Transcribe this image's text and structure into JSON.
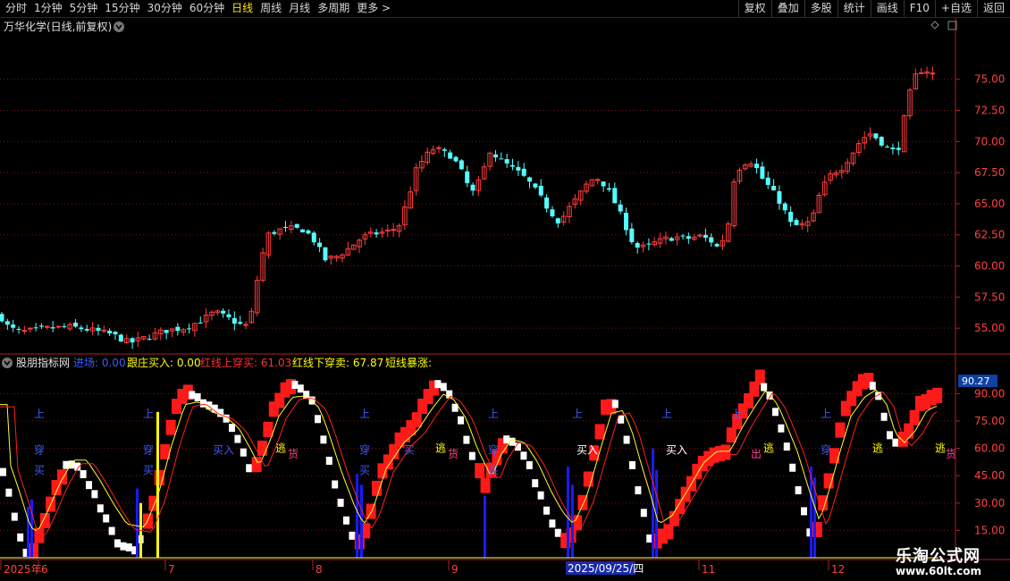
{
  "topbar": {
    "periods": [
      "分时",
      "1分钟",
      "5分钟",
      "15分钟",
      "30分钟",
      "60分钟",
      "日线",
      "周线",
      "月线",
      "多周期",
      "更多 >"
    ],
    "active_period": "日线",
    "tools": [
      "复权",
      "叠加",
      "多股",
      "统计",
      "画线",
      "F10",
      "+自选",
      "返回"
    ]
  },
  "main_panel": {
    "title": "万华化学(日线,前复权)",
    "y_ticks": [
      "75.00",
      "72.50",
      "70.00",
      "67.50",
      "65.00",
      "62.50",
      "60.00",
      "57.50",
      "55.00"
    ],
    "y_values": [
      75,
      72.5,
      70,
      67.5,
      65,
      62.5,
      60,
      57.5,
      55
    ],
    "y_range": [
      53,
      78.5
    ],
    "up_color": "#ff3c3c",
    "down_color": "#54ffff"
  },
  "indicator_panel": {
    "name": "股朋指标网",
    "legend": [
      {
        "label": "进场: 0.00",
        "color": "#3c5cff"
      },
      {
        "label": "跟庄买入: 0.00",
        "color": "#ffff00"
      },
      {
        "label": "红线上穿买: 61.03",
        "color": "#ff3030"
      },
      {
        "label": "红线下穿卖: 67.87",
        "color": "#ffff00"
      },
      {
        "label": "短线暴涨:",
        "color": "#ffff00"
      }
    ],
    "y_ticks": [
      "90.00",
      "75.00",
      "60.00",
      "45.00",
      "30.00",
      "15.00"
    ],
    "y_values": [
      90,
      75,
      60,
      45,
      30,
      15
    ],
    "y_range": [
      0,
      100
    ],
    "current_value": "90.27",
    "signals": [
      {
        "text": "上",
        "x": 38,
        "v": 77,
        "color": "#3c5cff"
      },
      {
        "text": "穿",
        "x": 38,
        "v": 57,
        "color": "#3c5cff"
      },
      {
        "text": "买",
        "x": 38,
        "v": 46,
        "color": "#3c5cff"
      },
      {
        "text": "上",
        "x": 160,
        "v": 77,
        "color": "#3c5cff"
      },
      {
        "text": "穿",
        "x": 160,
        "v": 57,
        "color": "#3c5cff"
      },
      {
        "text": "买",
        "x": 160,
        "v": 46,
        "color": "#3c5cff"
      },
      {
        "text": "买入",
        "x": 238,
        "v": 57,
        "color": "#3c5cff"
      },
      {
        "text": "逃",
        "x": 308,
        "v": 58,
        "color": "#ffff00"
      },
      {
        "text": "货",
        "x": 322,
        "v": 55,
        "color": "#ff4090"
      },
      {
        "text": "上",
        "x": 402,
        "v": 77,
        "color": "#3c5cff"
      },
      {
        "text": "穿",
        "x": 402,
        "v": 57,
        "color": "#3c5cff"
      },
      {
        "text": "买",
        "x": 402,
        "v": 46,
        "color": "#3c5cff"
      },
      {
        "text": "买",
        "x": 452,
        "v": 57,
        "color": "#3c5cff"
      },
      {
        "text": "逃",
        "x": 487,
        "v": 58,
        "color": "#ffff00"
      },
      {
        "text": "货",
        "x": 501,
        "v": 55,
        "color": "#ff4090"
      },
      {
        "text": "上",
        "x": 546,
        "v": 77,
        "color": "#3c5cff"
      },
      {
        "text": "穿",
        "x": 546,
        "v": 57,
        "color": "#3c5cff"
      },
      {
        "text": "买",
        "x": 546,
        "v": 46,
        "color": "#3c5cff"
      },
      {
        "text": "上",
        "x": 640,
        "v": 77,
        "color": "#3c5cff"
      },
      {
        "text": "买入",
        "x": 645,
        "v": 57,
        "color": "#ffffff"
      },
      {
        "text": "上",
        "x": 740,
        "v": 77,
        "color": "#3c5cff"
      },
      {
        "text": "买入",
        "x": 745,
        "v": 57,
        "color": "#ffffff"
      },
      {
        "text": "上",
        "x": 818,
        "v": 77,
        "color": "#3c5cff"
      },
      {
        "text": "出",
        "x": 840,
        "v": 55,
        "color": "#ff4090"
      },
      {
        "text": "逃",
        "x": 854,
        "v": 58,
        "color": "#ffff00"
      },
      {
        "text": "上",
        "x": 918,
        "v": 77,
        "color": "#3c5cff"
      },
      {
        "text": "穿",
        "x": 918,
        "v": 57,
        "color": "#3c5cff"
      },
      {
        "text": "逃",
        "x": 976,
        "v": 58,
        "color": "#ffff00"
      },
      {
        "text": "逃",
        "x": 1046,
        "v": 58,
        "color": "#ffff00"
      },
      {
        "text": "货",
        "x": 1058,
        "v": 55,
        "color": "#ff4090"
      }
    ]
  },
  "x_axis": {
    "labels": [
      {
        "text": "2025年",
        "x": 4
      },
      {
        "text": "6",
        "x": 46
      },
      {
        "text": "7",
        "x": 188
      },
      {
        "text": "8",
        "x": 353
      },
      {
        "text": "9",
        "x": 505
      },
      {
        "text": "11",
        "x": 785
      },
      {
        "text": "12",
        "x": 930
      }
    ],
    "cursor_date": "2025/09/25/四",
    "cursor_x": 633
  },
  "watermark": {
    "title": "乐淘公式网",
    "url": "www.60lt.com"
  }
}
